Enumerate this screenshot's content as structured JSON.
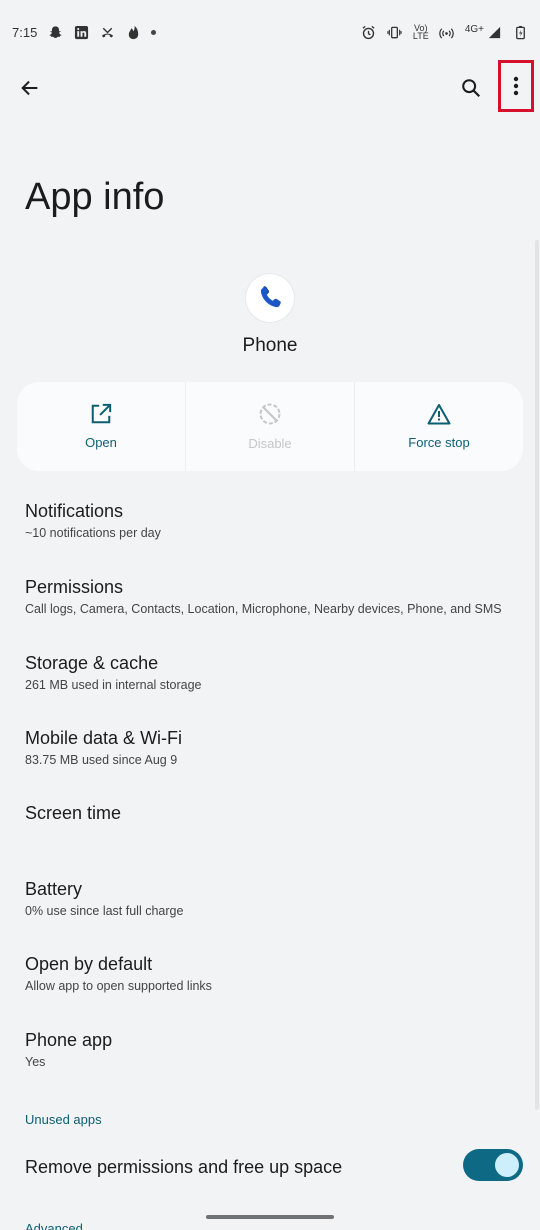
{
  "status_bar": {
    "time": "7:15",
    "left_icons": [
      "snapchat-icon",
      "linkedin-icon",
      "missed-call-icon",
      "tinder-icon",
      "dot-icon"
    ],
    "right_icons": [
      "alarm-icon",
      "vibrate-icon",
      "volte-icon",
      "hotspot-icon",
      "signal-4g-icon",
      "battery-icon"
    ],
    "net_top": "Vo)",
    "net_bottom": "LTE",
    "network": "4G+"
  },
  "top_bar": {
    "back_icon": "arrow-back-icon",
    "search_icon": "search-icon",
    "more_icon": "more-vert-icon",
    "highlight_color": "#d6102c"
  },
  "title": "App info",
  "app": {
    "name": "Phone",
    "icon": "phone-icon"
  },
  "actions": [
    {
      "label": "Open",
      "icon": "open-external-icon",
      "enabled": true
    },
    {
      "label": "Disable",
      "icon": "disable-icon",
      "enabled": false
    },
    {
      "label": "Force stop",
      "icon": "warning-icon",
      "enabled": true
    }
  ],
  "settings": [
    {
      "title": "Notifications",
      "subtitle": "~10 notifications per day"
    },
    {
      "title": "Permissions",
      "subtitle": "Call logs, Camera, Contacts, Location, Microphone, Nearby devices, Phone, and SMS"
    },
    {
      "title": "Storage & cache",
      "subtitle": "261 MB used in internal storage"
    },
    {
      "title": "Mobile data & Wi-Fi",
      "subtitle": "83.75 MB used since Aug 9"
    },
    {
      "title": "Screen time",
      "subtitle": ""
    },
    {
      "title": "Battery",
      "subtitle": "0% use since last full charge"
    },
    {
      "title": "Open by default",
      "subtitle": "Allow app to open supported links"
    },
    {
      "title": "Phone app",
      "subtitle": "Yes"
    }
  ],
  "unused_apps": {
    "header": "Unused apps",
    "toggle_label": "Remove permissions and free up space",
    "toggle_on": true
  },
  "advanced_header": "Advanced",
  "colors": {
    "accent": "#0c5f73",
    "toggle": "#0e6a84",
    "background": "#f1f3f5"
  }
}
